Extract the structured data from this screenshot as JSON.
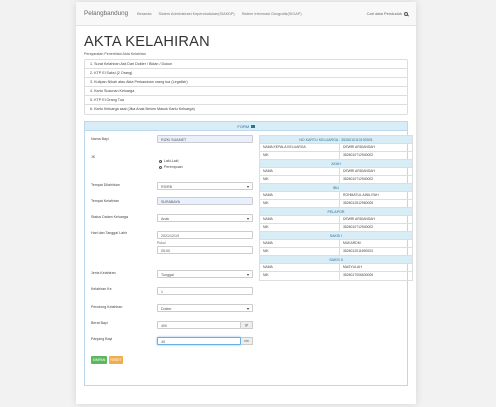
{
  "navbar": {
    "brand": "Pelangbandung",
    "links": [
      "Beranda",
      "Sistem Administrasi Kependudukan(SIAKDP)",
      "Sistem Informasi Geografis(SIGAP)"
    ],
    "search_label": "Cari data Penduduk"
  },
  "page": {
    "title": "AKTA KELAHIRAN",
    "subtitle": "Persyaratan Penerbitan Akta Kelahiran"
  },
  "requirements": [
    "1. Surat Kelahiran Asli Dari Dokter / Bidan / Dukun",
    "2. KTP El Saksi (2 Orang)",
    "3. Kutipan Nikah atau Akta Perkawinan orang tua (Legalisir)",
    "4. Kartu Susunan Keluarga",
    "5. KTP El Orang Tua",
    "6. Kartu Keluarga asal (Jika Anak Belum Masuk Kartu Keluarga)"
  ],
  "form": {
    "panel_title": "FORM",
    "nama_bayi": {
      "label": "Nama Bayi",
      "value": "RIZKI SUAMET"
    },
    "jk": {
      "label": "JK",
      "options": [
        "Laki-Laki",
        "Perempuan"
      ],
      "selected": "Laki-Laki"
    },
    "tempat_dilahirkan": {
      "label": "Tempat Dilahirkan",
      "value": "RS/RB"
    },
    "tempat_kelahiran": {
      "label": "Tempat Kelahiran",
      "value": "SURABAYA"
    },
    "status_keluarga": {
      "label": "Status Dalam Keluarga",
      "value": "Anak"
    },
    "hari_tanggal": {
      "label": "Hari dan Tanggal Lahir",
      "date": "2021/12/19",
      "jam_label": "Pukul",
      "time": "05:00"
    },
    "jenis_kelahiran": {
      "label": "Jenis Kelahiran",
      "value": "Tunggal"
    },
    "kelahiran_ke": {
      "label": "Kelahiran Ke",
      "value": "1"
    },
    "penolong": {
      "label": "Penolong Kelahiran",
      "value": "Dokter"
    },
    "berat_bayi": {
      "label": "Berat Bayi",
      "value": "400",
      "unit": "gr"
    },
    "panjang_bayi": {
      "label": "Panjang Bayi",
      "value": "45",
      "unit": "cm"
    },
    "simpan_label": "SIMPAN",
    "reset_label": "RESET"
  },
  "info": {
    "kk_header": "NO KARTU KELUARGA : 3526010110190001",
    "kk_rows": [
      {
        "k": "NAMA KEPALA KELUARGA",
        "v": "DEWRI ARDIANSAH"
      },
      {
        "k": "NIK",
        "v": "3526010712940002"
      }
    ],
    "ayah_header": "AYAH",
    "ayah_rows": [
      {
        "k": "NAMA",
        "v": "DEWRI ARDIANSAH"
      },
      {
        "k": "NIK",
        "v": "3526010712940002"
      }
    ],
    "ibu_header": "IBU",
    "ibu_rows": [
      {
        "k": "NAMA",
        "v": "ROHMATUL AINILIYAH"
      },
      {
        "k": "NIK",
        "v": "3526012512960005"
      }
    ],
    "pelapor_header": "PELAPOR",
    "pelapor_rows": [
      {
        "k": "NAMA",
        "v": "DEWRI ARDIANSAH"
      },
      {
        "k": "NIK",
        "v": "3526010712940002"
      }
    ],
    "saksi1_header": "SAKSI I",
    "saksi1_rows": [
      {
        "k": "NAMA",
        "v": "MUKARDM"
      },
      {
        "k": "NIK",
        "v": "3526012011690003"
      }
    ],
    "saksi2_header": "SAKSI II",
    "saksi2_rows": [
      {
        "k": "NAMA",
        "v": "MASYULAH"
      },
      {
        "k": "NIK",
        "v": "3526017006630005"
      }
    ]
  }
}
